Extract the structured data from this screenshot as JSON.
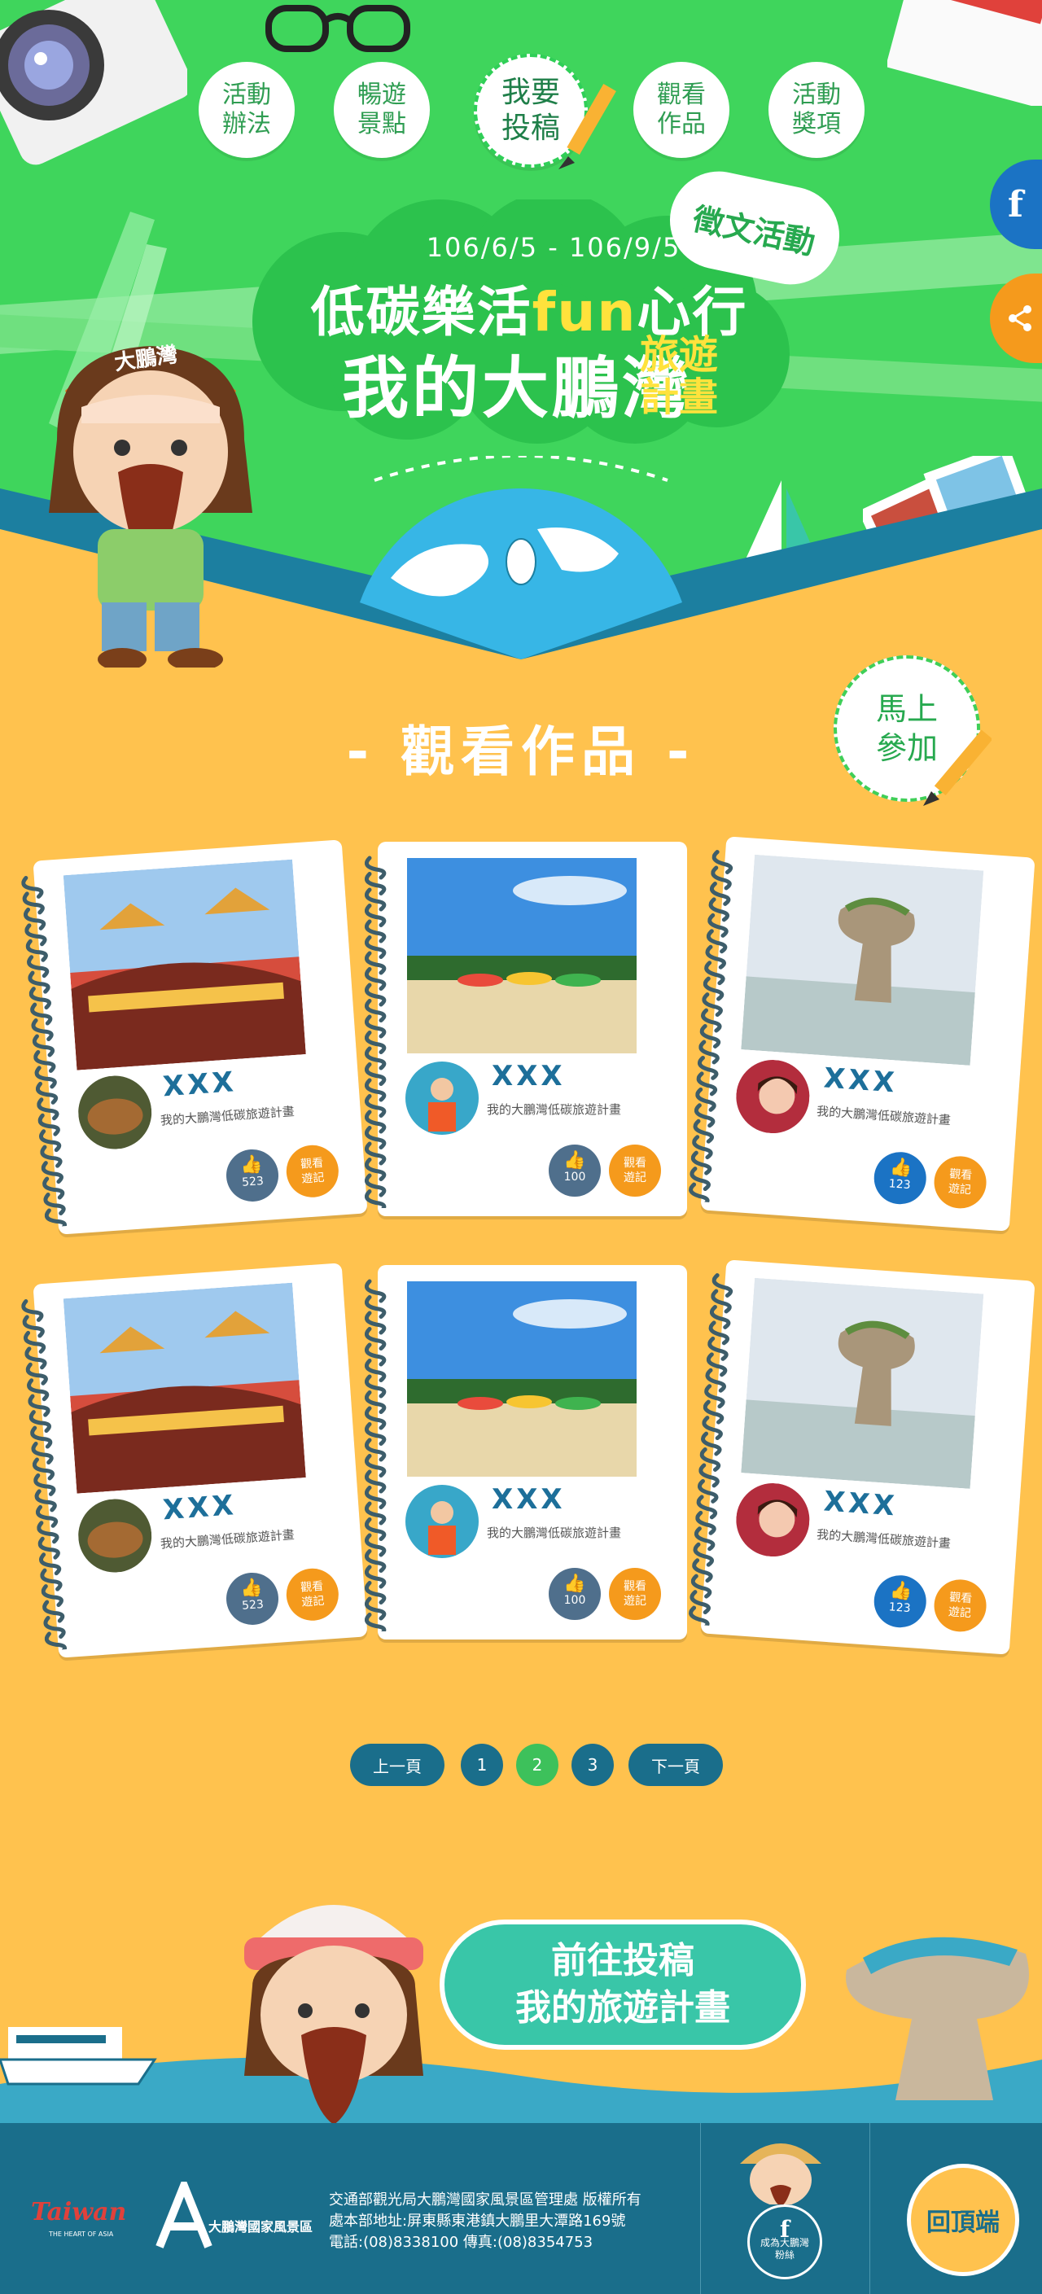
{
  "nav": {
    "items": [
      {
        "label": "活動\n辦法"
      },
      {
        "label": "暢遊\n景點"
      },
      {
        "label": "我要\n投稿"
      },
      {
        "label": "觀看\n作品"
      },
      {
        "label": "活動\n獎項"
      }
    ]
  },
  "social": {
    "facebook_icon": "f",
    "share_icon": "share-icon"
  },
  "hero": {
    "tag": "徵文活動",
    "dates": "106/6/5 - 106/9/5",
    "line1_a": "低碳樂活",
    "line1_fun": "fun",
    "line1_b": "心行",
    "line2": "我的大鵬灣",
    "line2_small": "旅遊計畫",
    "mascot_cap": "大鵬灣"
  },
  "section": {
    "title": "- 觀看作品 -",
    "join_label": "馬上\n參加"
  },
  "cards": [
    {
      "name": "XXX",
      "desc": "我的大鵬灣低碳旅遊計畫",
      "likes": "523",
      "view": "觀看\n遊記",
      "photo": "temple-boat",
      "avatar": "food",
      "like_style": "gray"
    },
    {
      "name": "XXX",
      "desc": "我的大鵬灣低碳旅遊計畫",
      "likes": "100",
      "view": "觀看\n遊記",
      "photo": "beach",
      "avatar": "diver",
      "like_style": "gray"
    },
    {
      "name": "XXX",
      "desc": "我的大鵬灣低碳旅遊計畫",
      "likes": "123",
      "view": "觀看\n遊記",
      "photo": "rock",
      "avatar": "girl",
      "like_style": "blue"
    },
    {
      "name": "XXX",
      "desc": "我的大鵬灣低碳旅遊計畫",
      "likes": "523",
      "view": "觀看\n遊記",
      "photo": "temple-boat",
      "avatar": "food",
      "like_style": "gray"
    },
    {
      "name": "XXX",
      "desc": "我的大鵬灣低碳旅遊計畫",
      "likes": "100",
      "view": "觀看\n遊記",
      "photo": "beach",
      "avatar": "diver",
      "like_style": "gray"
    },
    {
      "name": "XXX",
      "desc": "我的大鵬灣低碳旅遊計畫",
      "likes": "123",
      "view": "觀看\n遊記",
      "photo": "rock",
      "avatar": "girl",
      "like_style": "blue"
    }
  ],
  "pagination": {
    "prev": "上一頁",
    "pages": [
      "1",
      "2",
      "3"
    ],
    "active": "2",
    "next": "下一頁"
  },
  "cta": {
    "label": "前往投稿\n我的旅遊計畫"
  },
  "footer": {
    "taiwan_logo": "Taiwan",
    "taiwan_sub": "THE HEART OF ASIA",
    "org_logo": "大鵬灣國家風景區",
    "line1": "交通部觀光局大鵬灣國家風景區管理處 版權所有",
    "line2": "處本部地址:屏東縣東港鎮大鵬里大潭路169號",
    "line3": "電話:(08)8338100 傳真:(08)8354753",
    "fan_label": "成為大鵬灣\n粉絲",
    "back_top": "回頂端"
  },
  "colors": {
    "hero_green": "#3fd55c",
    "page_yellow": "#ffc24e",
    "footer_teal": "#1a6e8b",
    "accent_orange": "#f59a1c",
    "facebook_blue": "#1b73c4"
  }
}
